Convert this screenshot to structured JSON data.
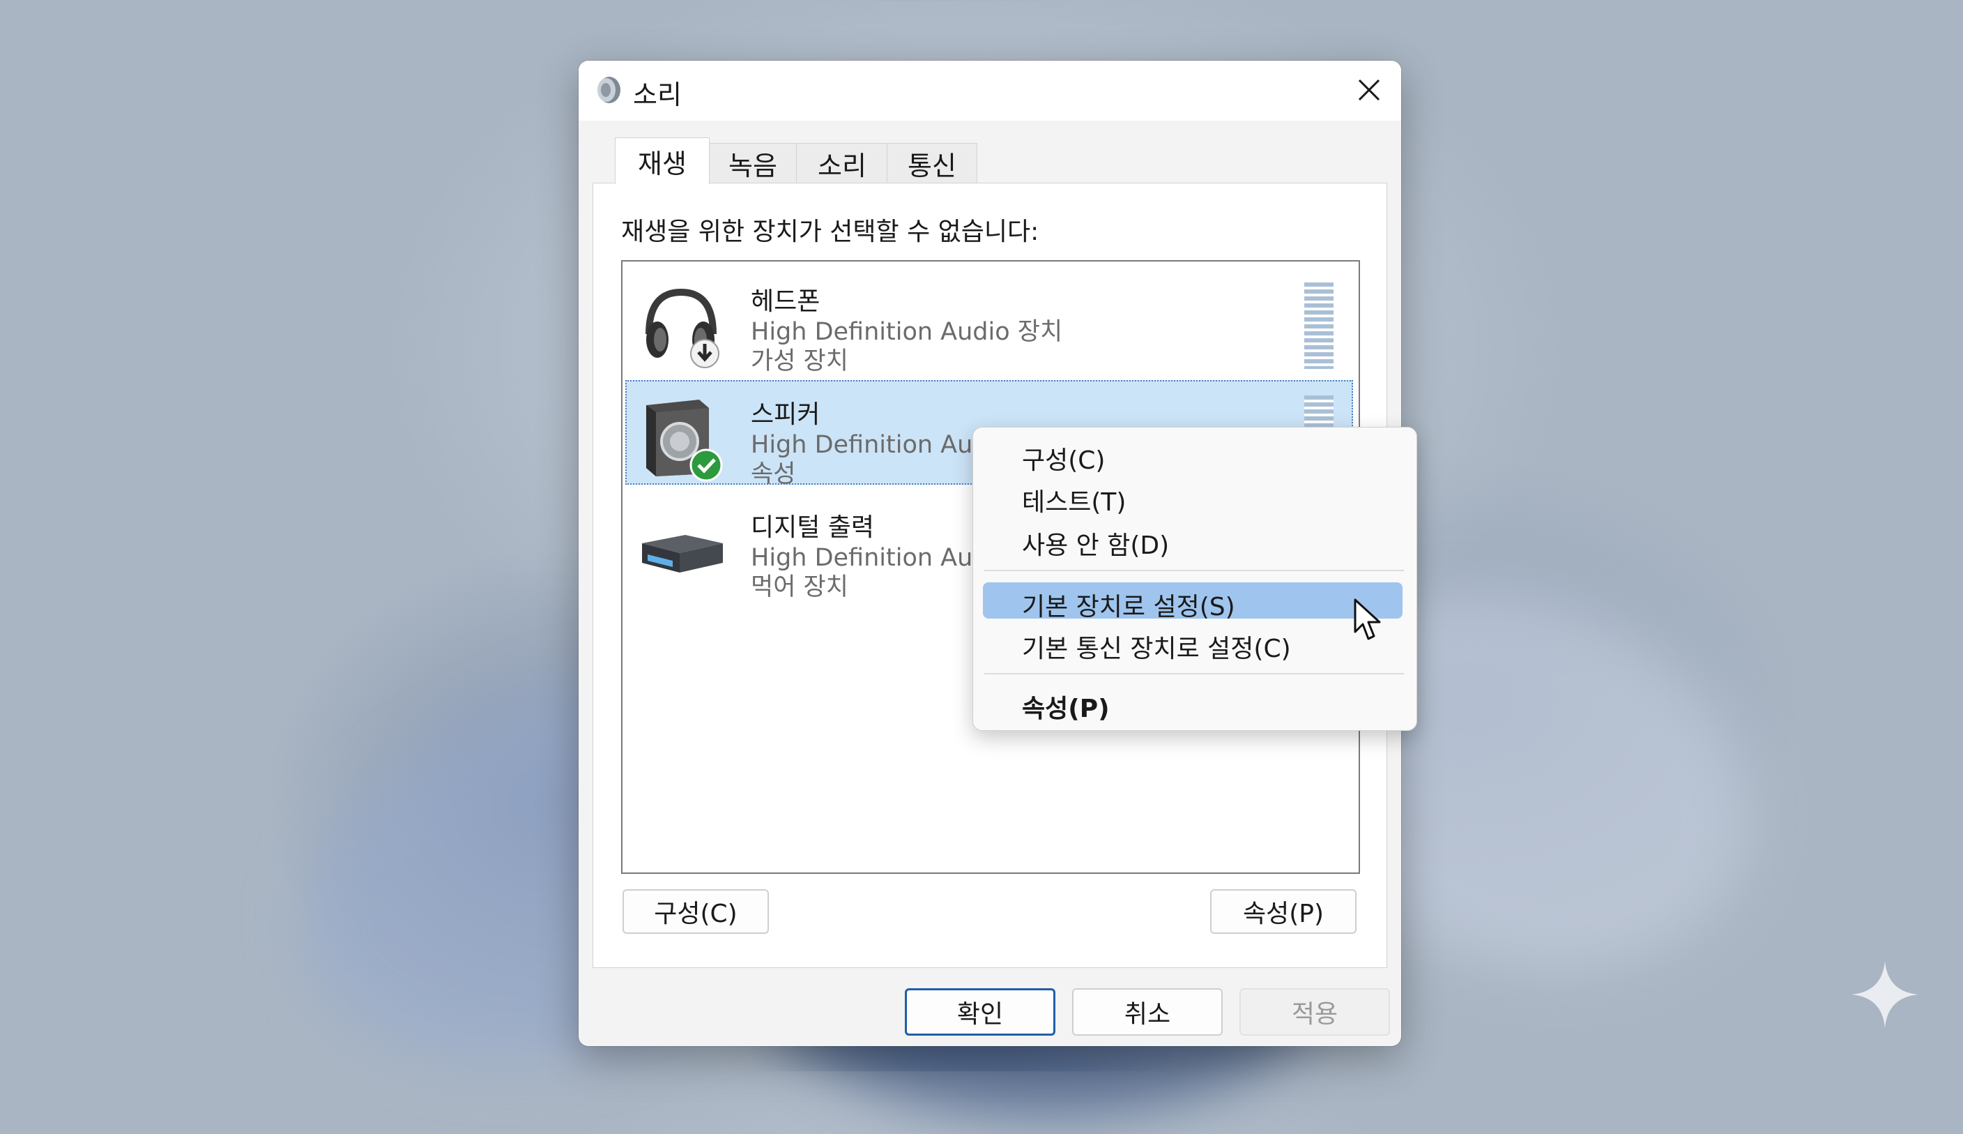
{
  "window": {
    "title": "소리",
    "close_glyph": "✕"
  },
  "tabs": [
    {
      "label": "재생",
      "active": true
    },
    {
      "label": "녹음",
      "active": false
    },
    {
      "label": "소리",
      "active": false
    },
    {
      "label": "통신",
      "active": false
    }
  ],
  "instruction": "재생을 위한 장치가 선택할 수 없습니다:",
  "devices": [
    {
      "name": "헤드폰",
      "driver": "High Definition Audio 장치",
      "status": "가성 장치",
      "icon": "headphones-icon",
      "badge": "download-arrow-icon",
      "selected": false,
      "meter": true
    },
    {
      "name": "스피커",
      "driver": "High Definition Audio 장치",
      "status": "속성",
      "icon": "speaker-icon",
      "badge": "green-check-icon",
      "selected": true,
      "meter": true
    },
    {
      "name": "디지털 출력",
      "driver": "High Definition Audio 장치",
      "status": "먹어 장치",
      "icon": "digital-output-icon",
      "badge": "",
      "selected": false,
      "meter": false
    }
  ],
  "buttons": {
    "configure": "구성(C)",
    "properties": "속성(P)",
    "ok": "확인",
    "cancel": "취소",
    "apply": "적용"
  },
  "context_menu": {
    "items": [
      {
        "label": "구성(C)",
        "state": "normal"
      },
      {
        "label": "테스트(T)",
        "state": "normal"
      },
      {
        "label": "사용 안 함(D)",
        "state": "normal"
      },
      {
        "label": "기본 장치로 설정(S)",
        "state": "hover"
      },
      {
        "label": "기본 통신 장치로 설정(C)",
        "state": "normal"
      },
      {
        "label": "속성(P)",
        "state": "bold"
      }
    ]
  },
  "colors": {
    "selection": "#cce4f7",
    "menu_hover": "#9fc5ee",
    "check_green": "#2e9a3e",
    "primary_border": "#1f5fa8"
  }
}
